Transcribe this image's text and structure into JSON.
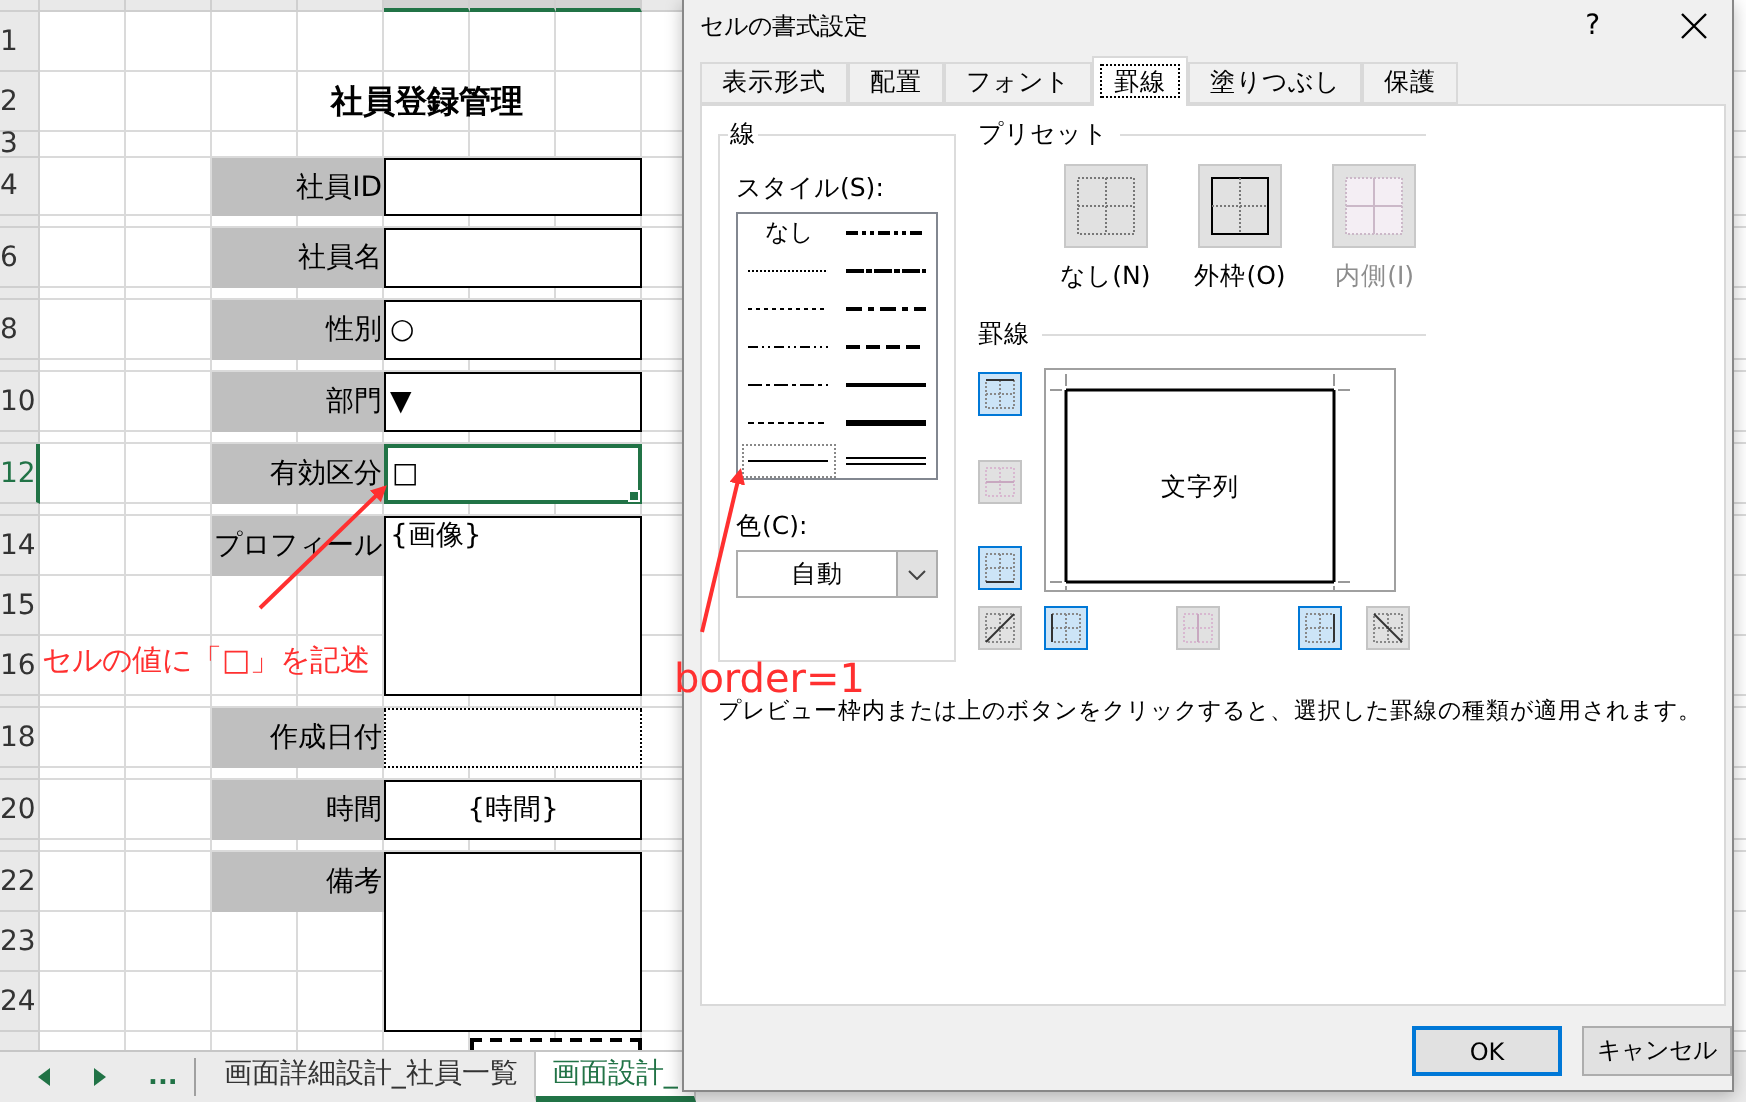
{
  "sheet": {
    "title": "社員登録管理",
    "row_headers": [
      "1",
      "2",
      "3",
      "4",
      "6",
      "8",
      "10",
      "12",
      "14",
      "15",
      "16",
      "18",
      "20",
      "22",
      "23",
      "24"
    ],
    "fields": [
      {
        "label": "社員ID",
        "kind": "text",
        "selected": false
      },
      {
        "label": "社員名",
        "kind": "text",
        "selected": false
      },
      {
        "label": "性別",
        "kind": "radio",
        "value": "○",
        "selected": false
      },
      {
        "label": "部門",
        "kind": "dropdown",
        "value": "▼",
        "selected": false
      },
      {
        "label": "有効区分",
        "kind": "checkbox",
        "value": "□",
        "selected": true
      },
      {
        "label": "プロフィール",
        "kind": "image",
        "value": "{画像}",
        "selected": false
      },
      {
        "label": "作成日付",
        "kind": "date",
        "selected": false
      },
      {
        "label": "時間",
        "kind": "time",
        "value": "{時間}",
        "selected": false
      },
      {
        "label": "備考",
        "kind": "memo",
        "selected": false
      }
    ],
    "more_tabs": "...",
    "tabs": [
      {
        "label": "画面詳細設計_社員一覧",
        "selected": false
      },
      {
        "label": "画面設計_",
        "selected": true
      }
    ]
  },
  "annotations": [
    {
      "text": "セルの値に「□」を記述"
    },
    {
      "text": "border=1"
    }
  ],
  "dialog": {
    "title": "セルの書式設定",
    "help": "?",
    "tabs": [
      {
        "label": "表示形式",
        "selected": false
      },
      {
        "label": "配置",
        "selected": false
      },
      {
        "label": "フォント",
        "selected": false
      },
      {
        "label": "罫線",
        "selected": true
      },
      {
        "label": "塗りつぶし",
        "selected": false
      },
      {
        "label": "保護",
        "selected": false
      }
    ],
    "line": {
      "title": "線",
      "style_label": "スタイル(S):",
      "styles": [
        {
          "kind": "none",
          "label": "なし",
          "selected": false
        },
        {
          "kind": "medium-dash-dot-dot",
          "selected": false
        },
        {
          "kind": "hair",
          "selected": false
        },
        {
          "kind": "slanted-dash-dot",
          "selected": false
        },
        {
          "kind": "dotted",
          "selected": false
        },
        {
          "kind": "medium-dash-dot",
          "selected": false
        },
        {
          "kind": "dash-dot-dot",
          "selected": false
        },
        {
          "kind": "medium-dashed",
          "selected": false
        },
        {
          "kind": "dash-dot",
          "selected": false
        },
        {
          "kind": "medium",
          "selected": false
        },
        {
          "kind": "dashed",
          "selected": false
        },
        {
          "kind": "thick",
          "selected": false
        },
        {
          "kind": "thin",
          "selected": true
        },
        {
          "kind": "double",
          "selected": false
        }
      ],
      "color_label": "色(C):",
      "line_color": "自動"
    },
    "presets": {
      "title": "プリセット",
      "items": [
        {
          "kind": "none",
          "label": "なし(N)",
          "disabled": false
        },
        {
          "kind": "outline",
          "label": "外枠(O)",
          "disabled": false
        },
        {
          "kind": "inside",
          "label": "内側(I)",
          "disabled": true
        }
      ]
    },
    "borders": {
      "title": "罫線",
      "preview_text": "文字列",
      "buttons": [
        {
          "kind": "top",
          "on": true,
          "disabled": false
        },
        {
          "kind": "middle-h",
          "on": false,
          "disabled": true
        },
        {
          "kind": "bottom",
          "on": true,
          "disabled": false
        },
        {
          "kind": "diag-up",
          "on": false,
          "disabled": false
        },
        {
          "kind": "left",
          "on": true,
          "disabled": false
        },
        {
          "kind": "middle-v",
          "on": false,
          "disabled": true
        },
        {
          "kind": "right",
          "on": true,
          "disabled": false
        },
        {
          "kind": "diag-down",
          "on": false,
          "disabled": false
        }
      ]
    },
    "hint": "プレビュー枠内または上のボタンをクリックすると、選択した罫線の種類が適用されます。",
    "buttons": [
      {
        "label": "OK",
        "default": true
      },
      {
        "label": "キャンセル",
        "default": false
      }
    ]
  }
}
